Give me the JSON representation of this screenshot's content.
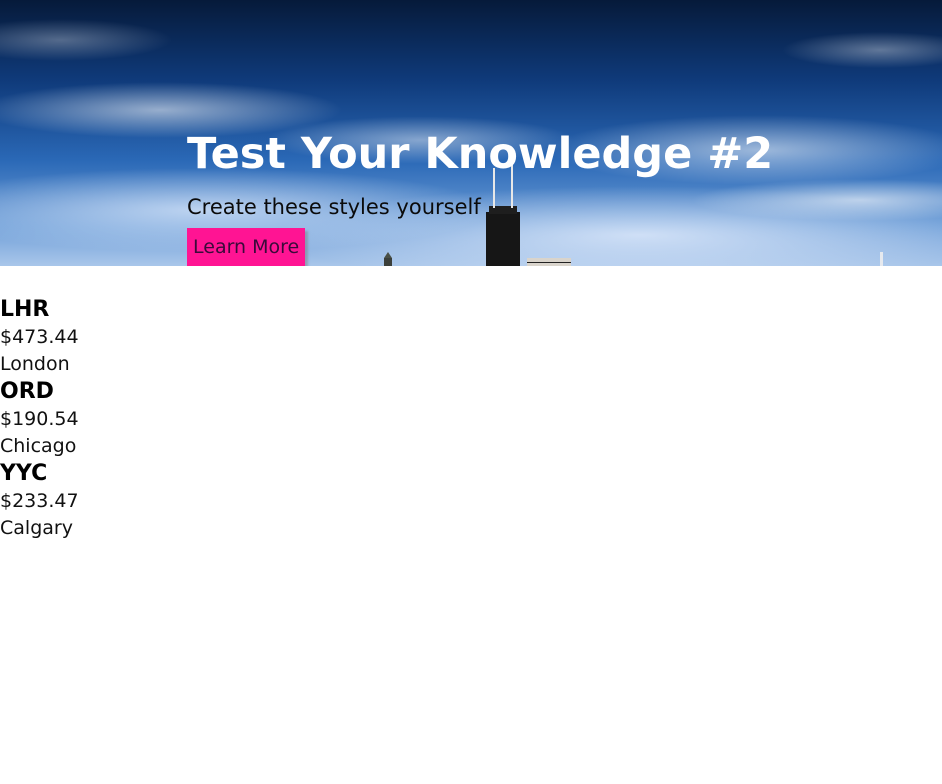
{
  "hero": {
    "title": "Test Your Knowledge #2",
    "subtitle": "Create these styles yourself",
    "button_label": "Learn More",
    "background_image": "city-skyline-sky-photo",
    "button_color": "#ff1493"
  },
  "flights": [
    {
      "code": "LHR",
      "price": "$473.44",
      "city": "London"
    },
    {
      "code": "ORD",
      "price": "$190.54",
      "city": "Chicago"
    },
    {
      "code": "YYC",
      "price": "$233.47",
      "city": "Calgary"
    }
  ]
}
